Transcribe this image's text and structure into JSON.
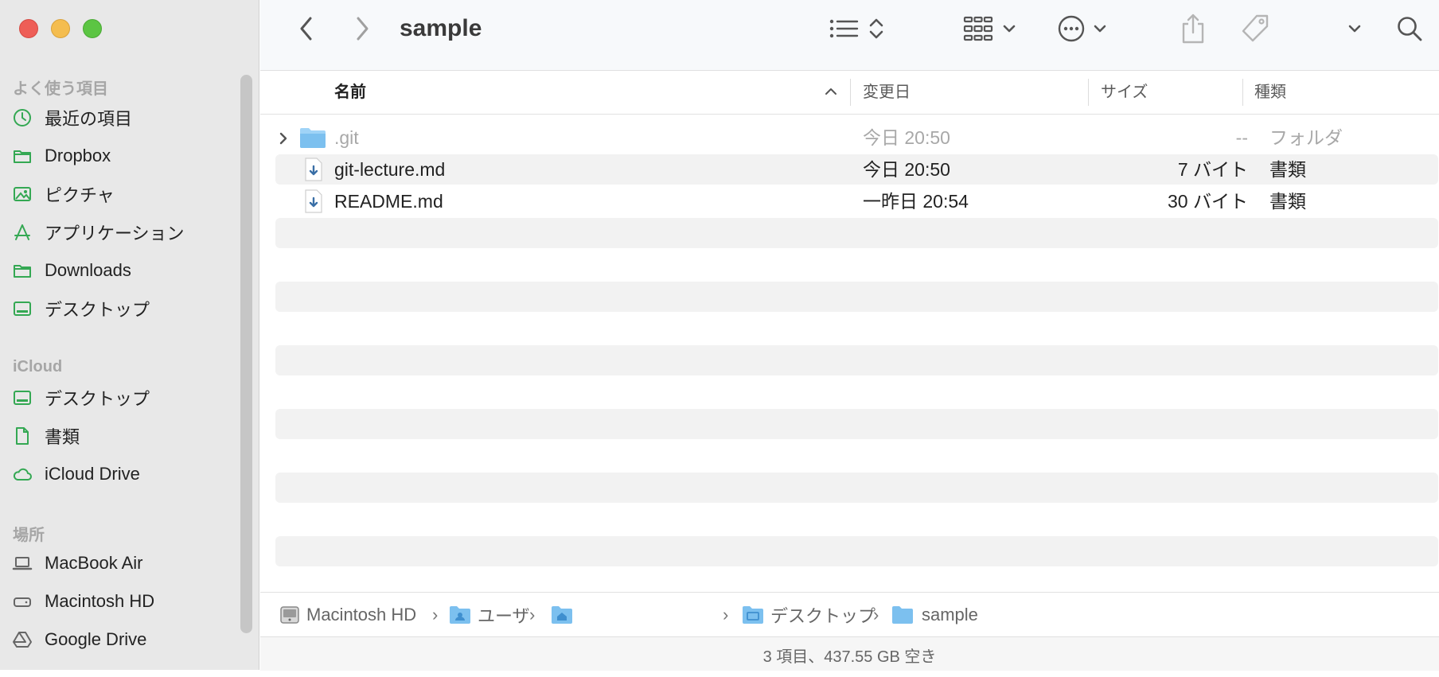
{
  "window": {
    "title": "sample"
  },
  "sidebar": {
    "sections": [
      {
        "title": "よく使う項目",
        "items": [
          {
            "label": "最近の項目",
            "icon": "clock-icon"
          },
          {
            "label": "Dropbox",
            "icon": "folder-icon"
          },
          {
            "label": "ピクチャ",
            "icon": "photo-icon"
          },
          {
            "label": "アプリケーション",
            "icon": "applications-icon"
          },
          {
            "label": "Downloads",
            "icon": "folder-icon"
          },
          {
            "label": "デスクトップ",
            "icon": "desktop-icon"
          }
        ]
      },
      {
        "title": "iCloud",
        "items": [
          {
            "label": "デスクトップ",
            "icon": "desktop-icon"
          },
          {
            "label": "書類",
            "icon": "document-icon"
          },
          {
            "label": "iCloud Drive",
            "icon": "cloud-icon"
          }
        ]
      },
      {
        "title": "場所",
        "items": [
          {
            "label": "MacBook Air",
            "icon": "laptop-icon"
          },
          {
            "label": "Macintosh HD",
            "icon": "disk-icon"
          },
          {
            "label": "Google Drive",
            "icon": "google-drive-icon"
          }
        ]
      }
    ]
  },
  "columns": {
    "name": "名前",
    "modified": "変更日",
    "size": "サイズ",
    "kind": "種類"
  },
  "files": [
    {
      "name": ".git",
      "modified": "今日 20:50",
      "size": "--",
      "kind": "フォルダ",
      "icon": "folder-icon",
      "expandable": true
    },
    {
      "name": "git-lecture.md",
      "modified": "今日 20:50",
      "size": "7 バイト",
      "kind": "書類",
      "icon": "markdown-file-icon"
    },
    {
      "name": "README.md",
      "modified": "一昨日 20:54",
      "size": "30 バイト",
      "kind": "書類",
      "icon": "markdown-file-icon"
    }
  ],
  "pathbar": [
    {
      "label": "Macintosh HD",
      "icon": "disk-icon"
    },
    {
      "label": "ユーザ",
      "icon": "users-folder-icon"
    },
    {
      "label": "",
      "icon": "home-folder-icon"
    },
    {
      "label": "デスクトップ",
      "icon": "desktop-folder-icon"
    },
    {
      "label": "sample",
      "icon": "folder-icon"
    }
  ],
  "status": "3 項目、437.55 GB 空き",
  "colors": {
    "accent": "#34a853",
    "sidebar_bg": "#e8e8e8",
    "folder": "#7cc0ef",
    "stripe": "#f2f2f2"
  }
}
